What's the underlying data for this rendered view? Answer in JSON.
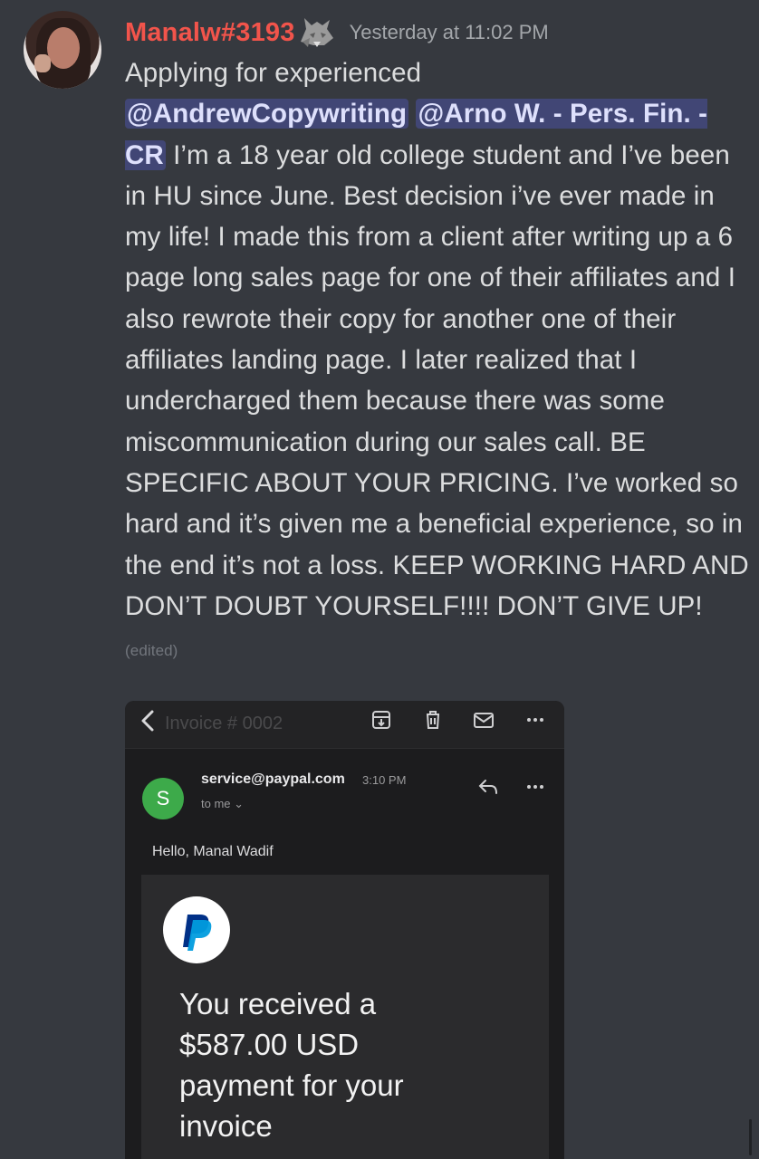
{
  "message": {
    "username": "Manalw#3193",
    "timestamp": "Yesterday at 11:02 PM",
    "intro": "Applying for experienced",
    "mention_1": "@AndrewCopywriting",
    "mention_2": "@Arno W. - Pers. Fin. - CR",
    "text": "I’m a 18 year old college student and I’ve been in HU since June. Best decision i’ve ever made in my life! I made this from a client after writing up a 6 page long sales page for one of their affiliates and I also rewrote their copy for another one of their affiliates landing page. I later realized that I undercharged them because there was some miscommunication during our sales call. BE SPECIFIC ABOUT YOUR PRICING. I’ve worked so hard and it’s given me a beneficial experience, so in the end it’s not a loss. KEEP WORKING HARD AND DON’T DOUBT YOURSELF!!!! DON’T GIVE UP!",
    "edited": "(edited)",
    "colors": {
      "username": "#f2544b",
      "mention_bg": "#414675",
      "background": "#36393f"
    },
    "icons": [
      "wolf-icon"
    ]
  },
  "attachment": {
    "toolbar": {
      "faded_subject": "Invoice # 0002",
      "icons": [
        "back-icon",
        "archive-icon",
        "trash-icon",
        "mail-icon",
        "more-icon"
      ]
    },
    "email": {
      "sender_initial": "S",
      "sender": "service@paypal.com",
      "time": "3:10 PM",
      "to": "to me ⌄",
      "greeting": "Hello, Manal Wadif",
      "headline_1": "You received a",
      "headline_2": "$587.00 USD",
      "headline_3": "payment for your",
      "headline_4": "invoice",
      "colors": {
        "sender_avatar": "#3daa4a",
        "paypal_dark": "#003087",
        "paypal_light": "#009cde"
      }
    }
  }
}
